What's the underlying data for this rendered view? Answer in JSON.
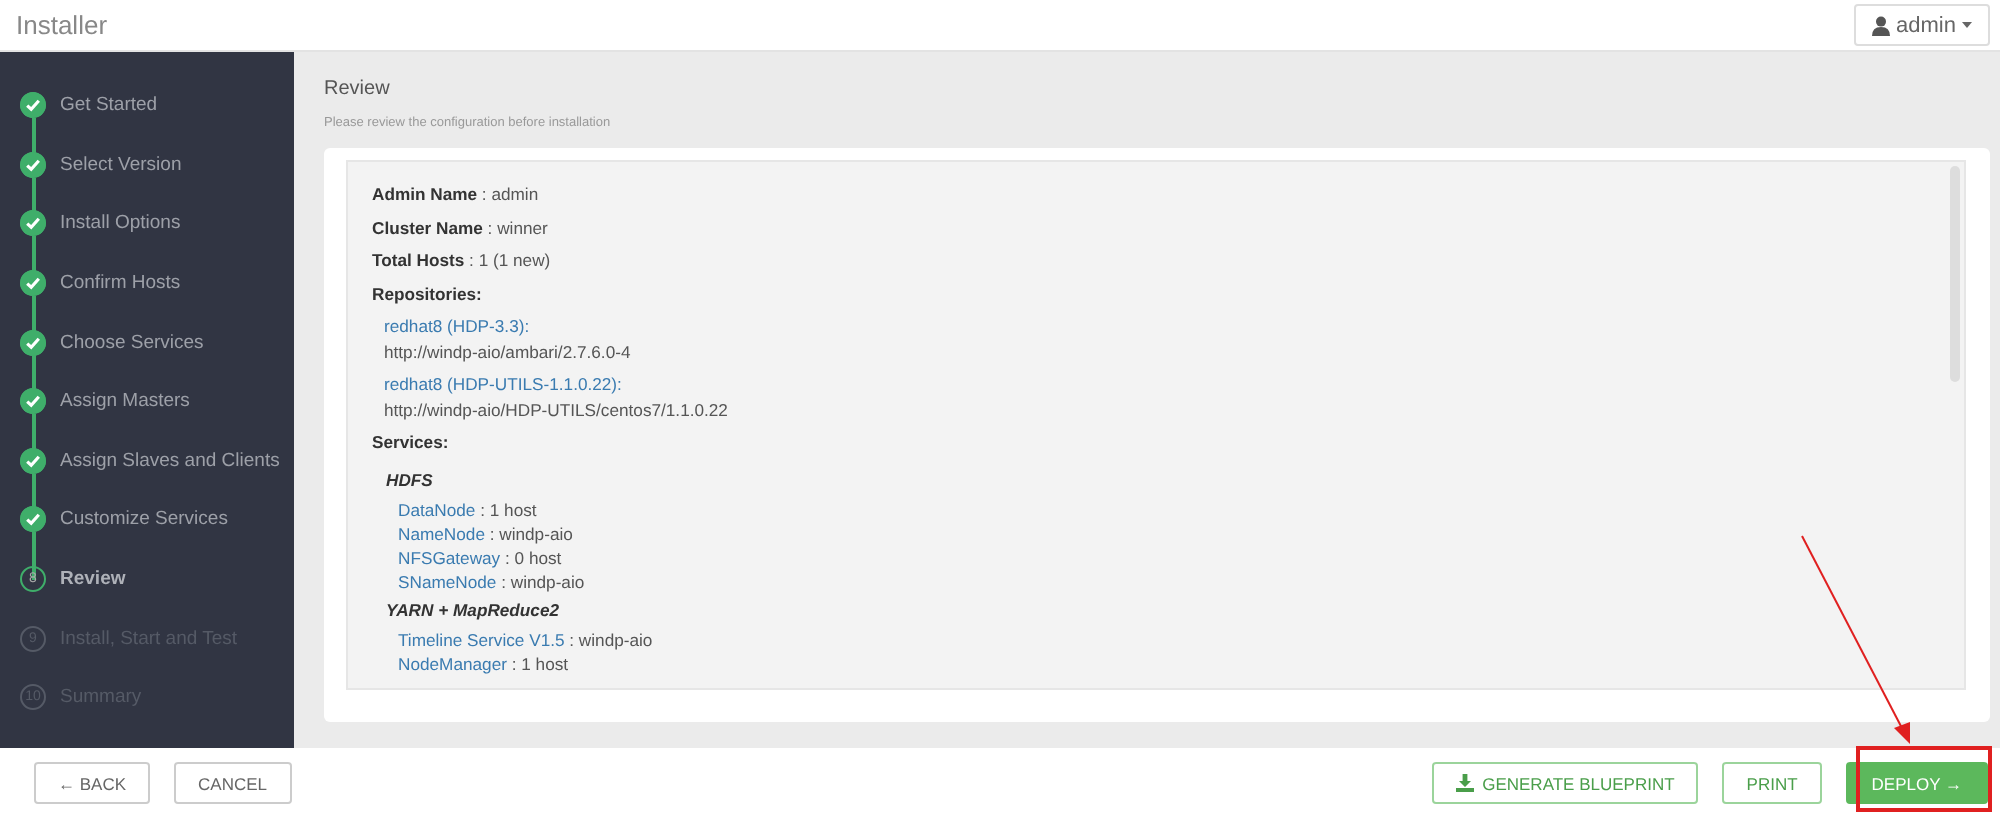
{
  "header": {
    "title": "Installer",
    "user_menu": {
      "label": "admin"
    }
  },
  "steps": [
    {
      "label": "Get Started",
      "completed": true,
      "selected": false
    },
    {
      "label": "Select Version",
      "completed": true,
      "selected": false
    },
    {
      "label": "Install Options",
      "completed": true,
      "selected": false
    },
    {
      "label": "Confirm Hosts",
      "completed": true,
      "selected": false
    },
    {
      "label": "Choose Services",
      "completed": true,
      "selected": false
    },
    {
      "label": "Assign Masters",
      "completed": true,
      "selected": false
    },
    {
      "label": "Assign Slaves and Clients",
      "completed": true,
      "selected": false
    },
    {
      "label": "Customize Services",
      "completed": true,
      "selected": false
    },
    {
      "label": "Review",
      "number": "8",
      "completed": false,
      "selected": true
    },
    {
      "label": "Install, Start and Test",
      "number": "9",
      "completed": false,
      "selected": false
    },
    {
      "label": "Summary",
      "number": "10",
      "completed": false,
      "selected": false
    }
  ],
  "review": {
    "title": "Review",
    "subtitle": "Please review the configuration before installation",
    "fields": [
      {
        "key": "Admin Name",
        "value": ": admin"
      },
      {
        "key": "Cluster Name",
        "value": ": winner"
      },
      {
        "key": "Total Hosts",
        "value": ": 1 (1 new)"
      }
    ],
    "repositories_label": "Repositories:",
    "repositories": [
      {
        "name": "redhat8 (HDP-3.3):",
        "url": "http://windp-aio/ambari/2.7.6.0-4"
      },
      {
        "name": "redhat8 (HDP-UTILS-1.1.0.22):",
        "url": "http://windp-aio/HDP-UTILS/centos7/1.1.0.22"
      }
    ],
    "services_label": "Services:",
    "services": [
      {
        "name": "HDFS",
        "components": [
          {
            "name": "DataNode",
            "value": ": 1 host"
          },
          {
            "name": "NameNode",
            "value": ": windp-aio"
          },
          {
            "name": "NFSGateway",
            "value": ": 0 host"
          },
          {
            "name": "SNameNode",
            "value": ": windp-aio"
          }
        ]
      },
      {
        "name": "YARN + MapReduce2",
        "components": [
          {
            "name": "Timeline Service V1.5",
            "value": ": windp-aio"
          },
          {
            "name": "NodeManager",
            "value": ": 1 host"
          }
        ]
      }
    ]
  },
  "footer": {
    "left_buttons": [
      {
        "label": "← BACK"
      },
      {
        "label": "CANCEL"
      }
    ],
    "right_buttons": [
      {
        "label": "GENERATE BLUEPRINT",
        "kind": "download"
      },
      {
        "label": "PRINT",
        "kind": "plain"
      },
      {
        "label": "DEPLOY →",
        "kind": "primary"
      }
    ]
  }
}
